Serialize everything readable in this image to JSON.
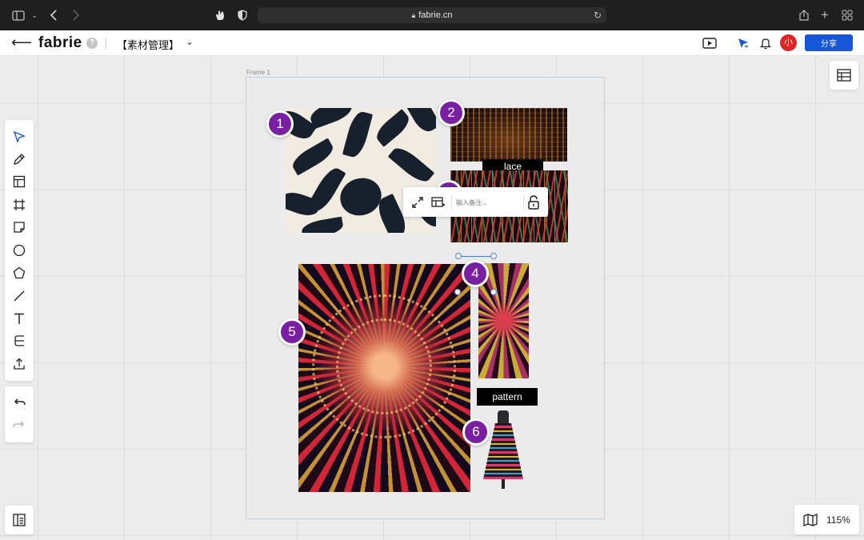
{
  "browser": {
    "url": "fabrie.cn",
    "icons": [
      "sidebar-icon",
      "chevron-down-icon",
      "back-icon",
      "forward-icon",
      "hand-icon",
      "shield-icon",
      "lock-icon",
      "reload-icon",
      "share-icon",
      "plus-icon",
      "tabs-grid-icon"
    ]
  },
  "header": {
    "logo": "fabrie",
    "help": "?",
    "project_name": "【素材管理】",
    "avatar_initial": "小",
    "share_label": "分享",
    "icons": [
      "back-arrow-icon",
      "present-icon",
      "cursor-icon",
      "bell-icon"
    ]
  },
  "canvas": {
    "frame_label": "Frame 1",
    "labels": {
      "lace": "lace",
      "pattern": "pattern"
    },
    "badges": [
      "1",
      "2",
      "3",
      "4",
      "5",
      "6"
    ],
    "note_placeholder": "输入备注...",
    "zoom": "115%"
  },
  "toolbar": {
    "tools": [
      "select-icon",
      "pen-icon",
      "layout-icon",
      "frame-icon",
      "sticky-note-icon",
      "circle-icon",
      "pentagon-icon",
      "line-icon",
      "text-icon",
      "connector-icon",
      "upload-icon"
    ],
    "history": [
      "undo-icon",
      "redo-icon"
    ]
  },
  "colors": {
    "accent": "#1656d8",
    "badge": "#7b1fa2",
    "avatar": "#e02424"
  }
}
